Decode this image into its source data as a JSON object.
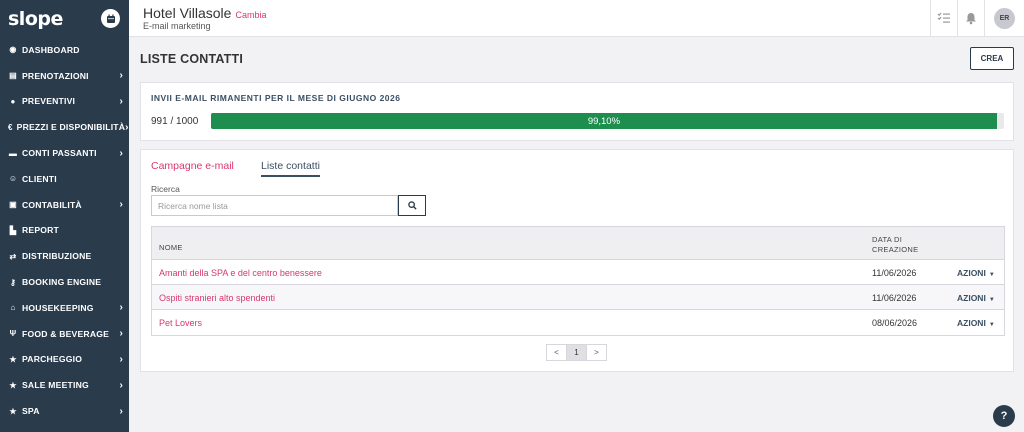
{
  "app": {
    "logo": "slope"
  },
  "sidebar": {
    "items": [
      {
        "label": "DASHBOARD",
        "icon": "dashboard-icon",
        "glyph": "◉",
        "chevron": false
      },
      {
        "label": "PRENOTAZIONI",
        "icon": "book-icon",
        "glyph": "▤",
        "chevron": true
      },
      {
        "label": "PREVENTIVI",
        "icon": "quote-icon",
        "glyph": "●",
        "chevron": true
      },
      {
        "label": "PREZZI E DISPONIBILITÀ",
        "icon": "euro-icon",
        "glyph": "€",
        "chevron": true
      },
      {
        "label": "CONTI PASSANTI",
        "icon": "card-icon",
        "glyph": "▬",
        "chevron": true
      },
      {
        "label": "CLIENTI",
        "icon": "users-icon",
        "glyph": "☺",
        "chevron": false
      },
      {
        "label": "CONTABILITÀ",
        "icon": "accounting-icon",
        "glyph": "▣",
        "chevron": true
      },
      {
        "label": "REPORT",
        "icon": "chart-icon",
        "glyph": "▙",
        "chevron": false
      },
      {
        "label": "DISTRIBUZIONE",
        "icon": "exchange-icon",
        "glyph": "⇄",
        "chevron": false
      },
      {
        "label": "BOOKING ENGINE",
        "icon": "key-icon",
        "glyph": "⚷",
        "chevron": false
      },
      {
        "label": "HOUSEKEEPING",
        "icon": "home-icon",
        "glyph": "⌂",
        "chevron": true
      },
      {
        "label": "FOOD & BEVERAGE",
        "icon": "cutlery-icon",
        "glyph": "ψ",
        "chevron": true
      },
      {
        "label": "PARCHEGGIO",
        "icon": "star-icon",
        "glyph": "★",
        "chevron": true
      },
      {
        "label": "SALE MEETING",
        "icon": "star-icon",
        "glyph": "★",
        "chevron": true
      },
      {
        "label": "SPA",
        "icon": "star-icon",
        "glyph": "★",
        "chevron": true
      }
    ]
  },
  "header": {
    "hotel_name": "Hotel Villasole",
    "change_label": "Cambia",
    "subtitle": "E-mail marketing",
    "avatar_initials": "ER"
  },
  "page": {
    "title": "LISTE CONTATTI",
    "create_label": "CREA"
  },
  "quota": {
    "title": "INVII E-MAIL RIMANENTI PER IL MESE DI GIUGNO 2026",
    "count": "991 / 1000",
    "progress_fraction": 0.991,
    "progress_label": "99,10%",
    "bar_color": "#1e8e4f"
  },
  "tabs": [
    {
      "label": "Campagne e-mail"
    },
    {
      "label": "Liste contatti"
    }
  ],
  "search": {
    "label": "Ricerca",
    "placeholder": "Ricerca nome lista",
    "value": ""
  },
  "table": {
    "headers": {
      "name": "NOME",
      "date_line1": "DATA DI",
      "date_line2": "CREAZIONE"
    },
    "rows": [
      {
        "name": "Amanti della SPA e del centro benessere",
        "date": "11/06/2026",
        "action": "AZIONI"
      },
      {
        "name": "Ospiti stranieri alto spendenti",
        "date": "11/06/2026",
        "action": "AZIONI"
      },
      {
        "name": "Pet Lovers",
        "date": "08/06/2026",
        "action": "AZIONI"
      }
    ]
  },
  "pagination": {
    "prev": "<",
    "current": "1",
    "next": ">"
  },
  "help": {
    "label": "?"
  },
  "colors": {
    "accent": "#d9376e",
    "navy": "#2a3b4c",
    "success": "#1e8e4f"
  }
}
